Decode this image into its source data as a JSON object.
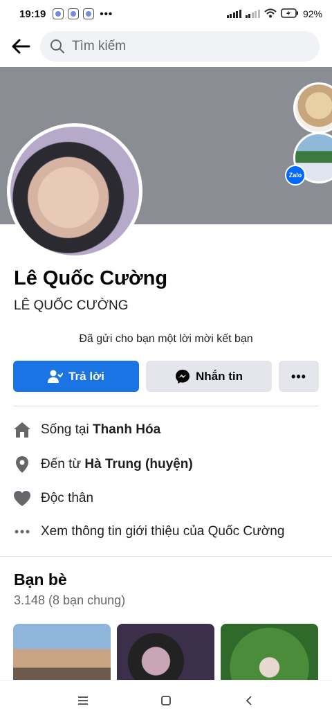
{
  "status_bar": {
    "time": "19:19",
    "more": "•••",
    "battery": "92%"
  },
  "search": {
    "placeholder": "Tìm kiếm"
  },
  "cover": {
    "zalo_badge": "Zalo"
  },
  "profile": {
    "name": "Lê Quốc Cường",
    "alt_name": "LÊ QUỐC CƯỜNG",
    "request_text": "Đã gửi cho bạn một lời mời kết bạn"
  },
  "actions": {
    "reply_label": "Trả lời",
    "message_label": "Nhắn tin",
    "more_label": "•••"
  },
  "details": {
    "lives_prefix": "Sống tại ",
    "lives_value": "Thanh Hóa",
    "from_prefix": "Đến từ ",
    "from_value": "Hà Trung (huyện)",
    "relationship": "Độc thân",
    "see_about": "Xem thông tin giới thiệu của Quốc Cường"
  },
  "friends": {
    "title": "Bạn bè",
    "count": "3.148 (8 bạn chung)"
  },
  "colors": {
    "accent": "#1b74e4",
    "cover": "#8a8d93",
    "secondary_button": "#e4e6eb"
  },
  "icons": {
    "back": "arrow-left-icon",
    "search": "search-icon",
    "reply": "person-icon",
    "message": "messenger-icon",
    "home": "house-icon",
    "from": "location-pin-icon",
    "relationship": "heart-icon",
    "more": "dots-icon"
  }
}
